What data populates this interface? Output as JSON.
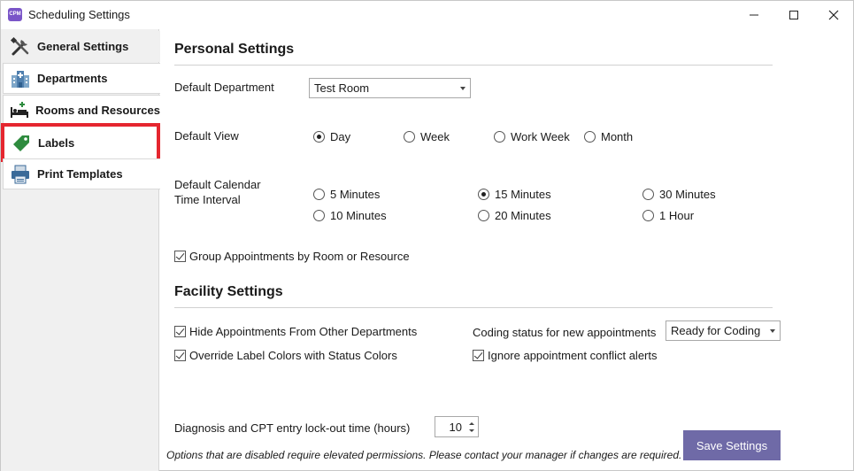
{
  "window": {
    "title": "Scheduling Settings",
    "app_icon_text": "CPM"
  },
  "sidebar": {
    "items": [
      {
        "label": "General Settings",
        "icon": "tools-icon"
      },
      {
        "label": "Departments",
        "icon": "hospital-icon"
      },
      {
        "label": "Rooms and Resources",
        "icon": "bed-icon"
      },
      {
        "label": "Labels",
        "icon": "tag-icon"
      },
      {
        "label": "Print Templates",
        "icon": "printer-icon"
      }
    ],
    "active_index": 0,
    "highlighted_index": 3
  },
  "personal": {
    "title": "Personal Settings",
    "default_department_label": "Default Department",
    "default_department_value": "Test Room",
    "default_view_label": "Default View",
    "views": [
      "Day",
      "Week",
      "Work Week",
      "Month"
    ],
    "selected_view": "Day",
    "interval_label_line1": "Default Calendar",
    "interval_label_line2": "Time Interval",
    "intervals": [
      "5 Minutes",
      "15 Minutes",
      "30 Minutes",
      "10 Minutes",
      "20 Minutes",
      "1 Hour"
    ],
    "selected_interval": "15 Minutes",
    "group_label": "Group Appointments by Room or Resource",
    "group_checked": true
  },
  "facility": {
    "title": "Facility Settings",
    "hide_label": "Hide Appointments From Other Departments",
    "hide_checked": true,
    "override_label": "Override Label Colors with Status Colors",
    "override_checked": true,
    "coding_label": "Coding status for new appointments",
    "coding_value": "Ready for Coding",
    "conflict_label": "Ignore appointment conflict alerts",
    "conflict_checked": true
  },
  "lockout": {
    "label": "Diagnosis and CPT entry lock-out time (hours)",
    "value": "10"
  },
  "footer": {
    "note": "Options that are disabled require elevated permissions.  Please contact your manager if changes are required.",
    "save_label": "Save Settings"
  },
  "colors": {
    "highlight_border": "#e5262f",
    "save_button": "#6f6aa7",
    "tag_green": "#2e8b3e"
  }
}
